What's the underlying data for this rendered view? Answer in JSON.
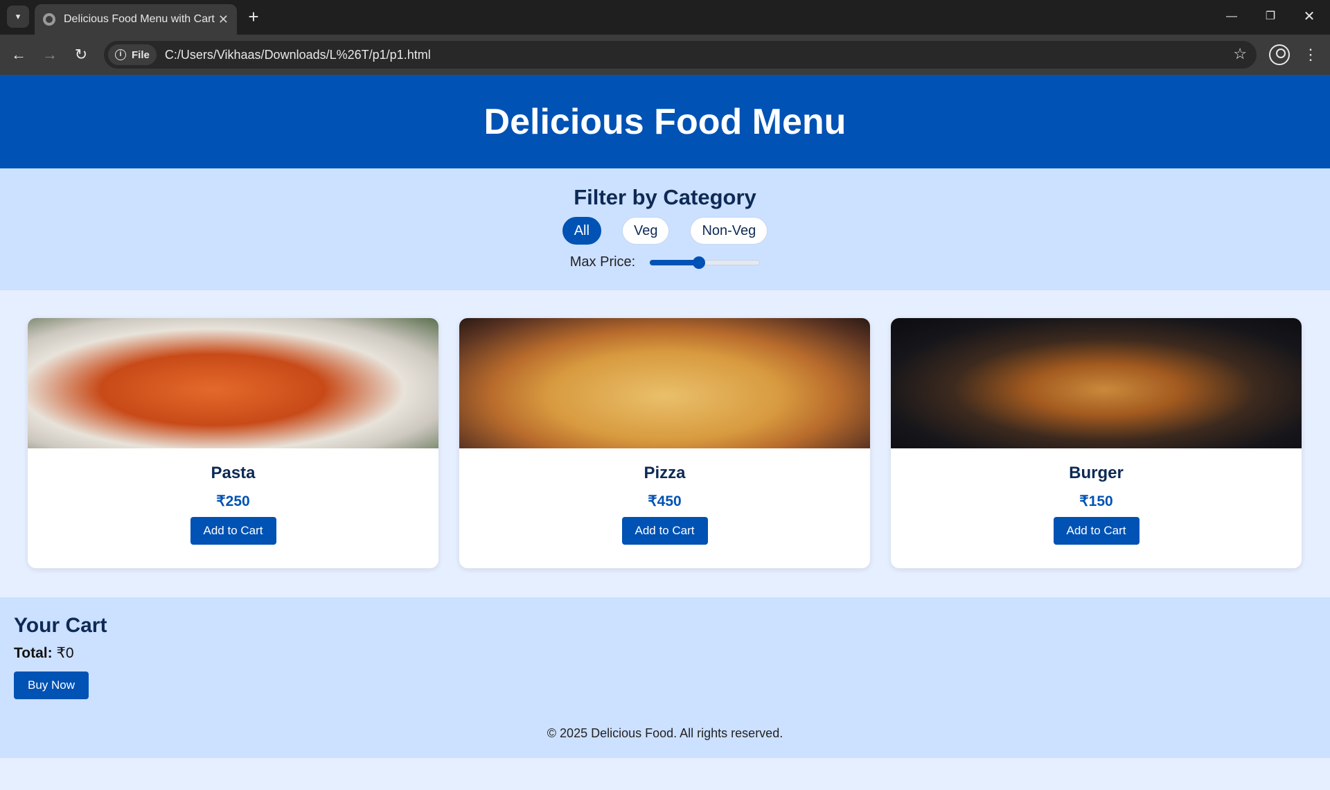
{
  "browser": {
    "tab_title": "Delicious Food Menu with Cart",
    "tab_close": "✕",
    "new_tab": "+",
    "file_chip": "File",
    "url": "C:/Users/Vikhaas/Downloads/L%26T/p1/p1.html",
    "window_controls": [
      "minimize",
      "restore",
      "close"
    ]
  },
  "header": {
    "title": "Delicious Food Menu"
  },
  "filters": {
    "heading": "Filter by Category",
    "categories": [
      {
        "label": "All",
        "active": true
      },
      {
        "label": "Veg",
        "active": false
      },
      {
        "label": "Non-Veg",
        "active": false
      }
    ],
    "max_price_label": "Max Price:",
    "slider_fraction": 0.45
  },
  "menu": {
    "items": [
      {
        "name": "Pasta",
        "price": "₹250",
        "button": "Add to Cart",
        "image": "pasta-photo"
      },
      {
        "name": "Pizza",
        "price": "₹450",
        "button": "Add to Cart",
        "image": "pizza-photo"
      },
      {
        "name": "Burger",
        "price": "₹150",
        "button": "Add to Cart",
        "image": "burger-photo"
      }
    ]
  },
  "cart": {
    "heading": "Your Cart",
    "total_label": "Total:",
    "total_value": "₹0",
    "buy_button": "Buy Now"
  },
  "footer": {
    "text": "© 2025 Delicious Food. All rights reserved."
  },
  "colors": {
    "brand": "#0052b4",
    "light_band": "#cce0ff",
    "page_bg": "#e6efff"
  }
}
